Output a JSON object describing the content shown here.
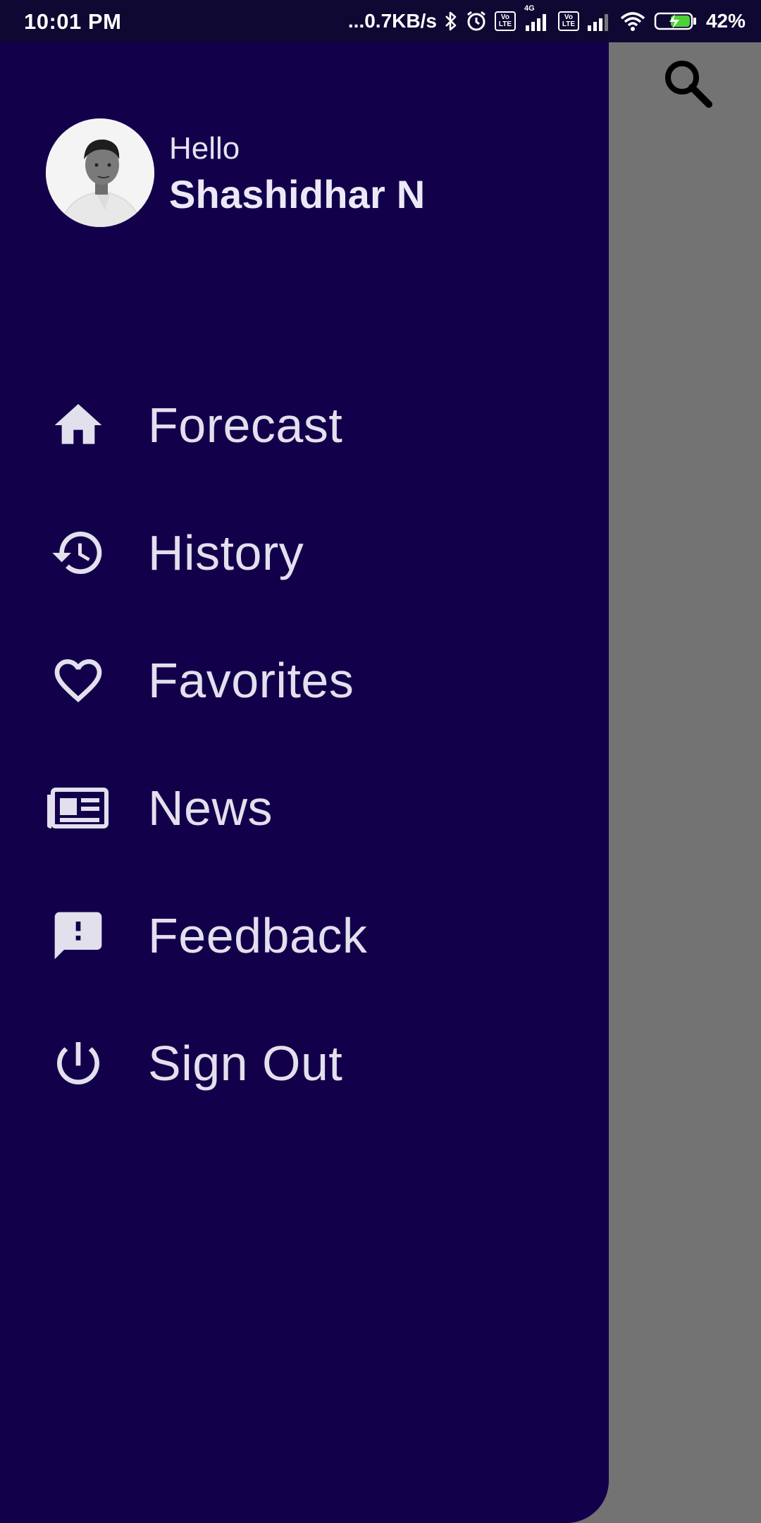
{
  "status_bar": {
    "time": "10:01 PM",
    "net_speed": "...0.7KB/s",
    "volte_label_top": "Vo",
    "volte_label_bottom": "LTE",
    "network_type": "4G",
    "battery_percent": "42%",
    "icons": [
      "bluetooth-icon",
      "alarm-icon",
      "volte-icon",
      "signal-icon",
      "wifi-icon",
      "battery-charging-icon"
    ]
  },
  "drawer": {
    "greeting": "Hello",
    "user_name": "Shashidhar N",
    "menu": [
      {
        "label": "Forecast",
        "icon": "home-icon"
      },
      {
        "label": "History",
        "icon": "history-icon"
      },
      {
        "label": "Favorites",
        "icon": "heart-icon"
      },
      {
        "label": "News",
        "icon": "newspaper-icon"
      },
      {
        "label": "Feedback",
        "icon": "feedback-icon"
      },
      {
        "label": "Sign Out",
        "icon": "power-icon"
      }
    ]
  },
  "toolbar": {
    "search_icon": "search-icon"
  },
  "colors": {
    "drawer_bg": "#13004b",
    "scrim": "#737373",
    "text": "#e3e0ee",
    "status_bg": "#0f0832"
  }
}
